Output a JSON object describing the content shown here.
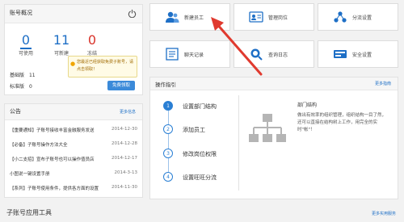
{
  "account": {
    "title": "账号概况",
    "stats": [
      {
        "value": "0",
        "label": "可使用",
        "color": "#1e6fc6"
      },
      {
        "value": "11",
        "label": "可新建",
        "color": "#1e6fc6"
      },
      {
        "value": "0",
        "label": "冻结",
        "color": "#d9342b"
      }
    ],
    "tip": "您最近已经获取免费子账号，请点击领取！",
    "rows": [
      {
        "label": "基础版",
        "value": "11"
      },
      {
        "label": "标准版",
        "value": "0"
      }
    ],
    "claim_button": "免费领取"
  },
  "announcements": {
    "title": "公告",
    "more": "更多信息",
    "items": [
      {
        "text": "【重要通知】子账号接收丰富金融服务发送",
        "date": "2014-12-30"
      },
      {
        "text": "【必备】子账号操作方法大全",
        "date": "2014-12-28"
      },
      {
        "text": "【小二支招】宣布子账号也可以操作值员店",
        "date": "2014-12-17"
      },
      {
        "text": "小图说一键设置手册",
        "date": "2014-3-13"
      },
      {
        "text": "【系列】子账号使用条件，提供各方面的设置",
        "date": "2014-11-30"
      }
    ]
  },
  "tiles": [
    {
      "label": "新建员工",
      "icon": "users-icon"
    },
    {
      "label": "管理岗位",
      "icon": "id-card-icon"
    },
    {
      "label": "分流设置",
      "icon": "distribution-icon"
    },
    {
      "label": "聊天记录",
      "icon": "document-icon"
    },
    {
      "label": "查询日志",
      "icon": "search-icon"
    },
    {
      "label": "安全设置",
      "icon": "security-icon"
    }
  ],
  "guide": {
    "title": "操作指引",
    "more": "更多指南",
    "steps": [
      "设置部门结构",
      "添加员工",
      "修改岗位权限",
      "设置旺旺分流"
    ],
    "detail_title": "部门结构",
    "detail_text": "做出有效率的组织管理，组织结构一目了然，还可以直接在结构树上工作，用完全的实时\"帐\"！"
  },
  "tools": {
    "title": "子账号应用工具",
    "more": "更多实用服务"
  },
  "colors": {
    "accent": "#1e6fc6",
    "danger": "#d9342b",
    "arrow": "#e03a2f"
  }
}
